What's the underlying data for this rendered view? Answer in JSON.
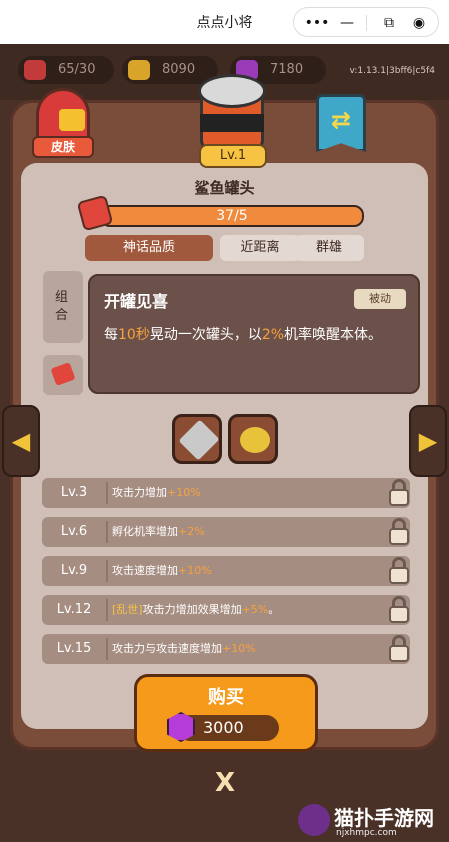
{
  "titlebar": {
    "title": "点点小将"
  },
  "resources": {
    "hearts": "65/30",
    "gold": "8090",
    "gems": "7180"
  },
  "version": "v:1.13.1|3bff6|c5f4",
  "buttons": {
    "skin": "皮肤"
  },
  "item": {
    "level": "Lv.1",
    "name": "鲨鱼罐头",
    "progress_text": "37/5",
    "progress_fraction": 1.0,
    "tags": [
      "神话品质",
      "近距离",
      "群雄"
    ]
  },
  "side_tabs": {
    "combo": "组合"
  },
  "popup": {
    "title": "开罐见喜",
    "badge": "被动",
    "desc_1": "每",
    "desc_num1": "10秒",
    "desc_2": "晃动一次罐头，以",
    "desc_num2": "2%",
    "desc_3": "机率唤醒本体。"
  },
  "levels": [
    {
      "lv": "Lv.3",
      "text": "攻击力增加",
      "plus": "+10%"
    },
    {
      "lv": "Lv.6",
      "text": "孵化机率增加",
      "plus": "+2%"
    },
    {
      "lv": "Lv.9",
      "text": "攻击速度增加",
      "plus": "+10%"
    },
    {
      "lv": "Lv.12",
      "kw": "[乱世]",
      "text": "攻击力增加效果增加",
      "plus": "+5%",
      "tail": "。"
    },
    {
      "lv": "Lv.15",
      "text": "攻击力与攻击速度增加",
      "plus": "+10%"
    }
  ],
  "buy": {
    "label": "购买",
    "price": "3000"
  },
  "close_label": "X",
  "watermark": {
    "title": "猫扑手游网",
    "url": "njxhmpc.com"
  },
  "colors": {
    "accent": "#f59a1b",
    "highlight": "#f6a23e",
    "panel": "#cfbfb7"
  }
}
